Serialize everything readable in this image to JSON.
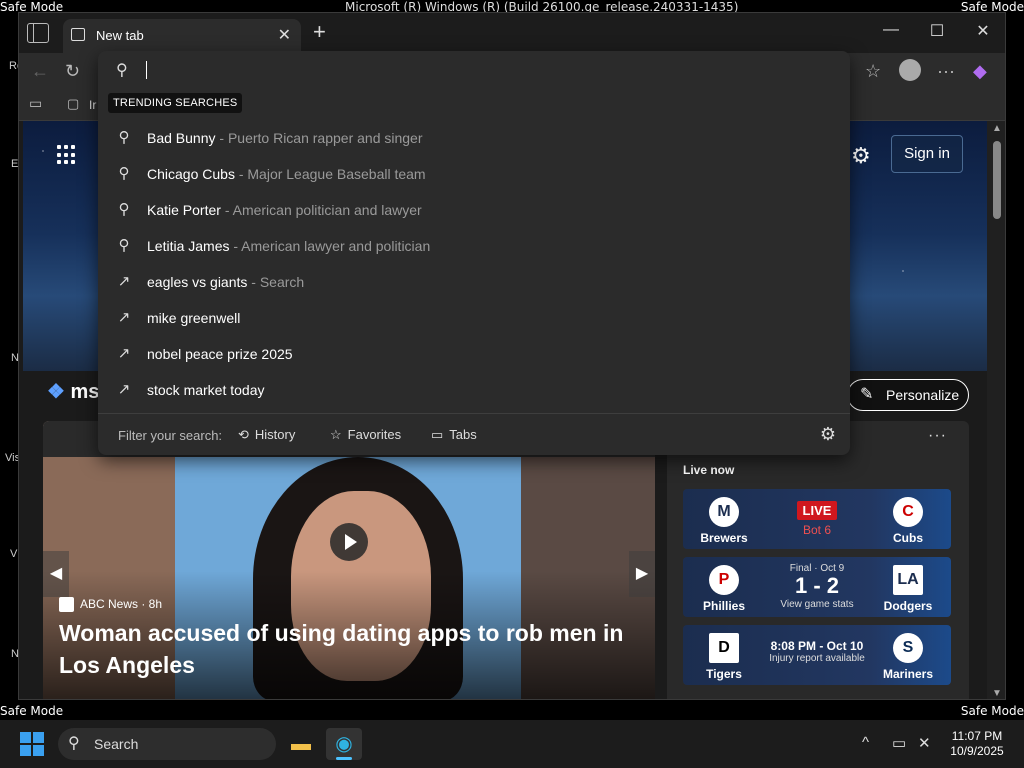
{
  "desktop": {
    "title_bar_text": "Microsoft (R) Windows (R) (Build 26100.ge_release.240331-1435)",
    "safe_mode_label": "Safe Mode",
    "icon_labels": [
      "Re",
      "E",
      "N",
      "Vis",
      "V",
      "N"
    ]
  },
  "browser": {
    "tab_title": "New tab",
    "favbar_item": "Ir"
  },
  "msn": {
    "logo_text": "ms",
    "sign_in": "Sign in",
    "personalize": "Personalize"
  },
  "search_dropdown": {
    "input_value": "",
    "section_label": "TRENDING SEARCHES",
    "suggestions": [
      {
        "icon": "search-icon",
        "term": "Bad Bunny",
        "desc": " - Puerto Rican rapper and singer"
      },
      {
        "icon": "search-icon",
        "term": "Chicago Cubs",
        "desc": " - Major League Baseball team"
      },
      {
        "icon": "search-icon",
        "term": "Katie Porter",
        "desc": " - American politician and lawyer"
      },
      {
        "icon": "search-icon",
        "term": "Letitia James",
        "desc": " - American lawyer and politician"
      },
      {
        "icon": "trending-icon",
        "term": "eagles vs giants",
        "desc": " - Search"
      },
      {
        "icon": "trending-icon",
        "term": "mike greenwell",
        "desc": ""
      },
      {
        "icon": "trending-icon",
        "term": "nobel peace prize 2025",
        "desc": ""
      },
      {
        "icon": "trending-icon",
        "term": "stock market today",
        "desc": ""
      }
    ],
    "filter_label": "Filter your search:",
    "filters": {
      "history": "History",
      "favorites": "Favorites",
      "tabs": "Tabs"
    }
  },
  "hero": {
    "source": "ABC News · 8h",
    "headline": "Woman accused of using dating apps to rob men in Los Angeles"
  },
  "sports": {
    "live_now": "Live now",
    "games": [
      {
        "home": "Brewers",
        "away": "Cubs",
        "badge": "LIVE",
        "status": "Bot 6",
        "home_logo": "M",
        "away_logo": "C"
      },
      {
        "home": "Phillies",
        "away": "Dodgers",
        "header": "Final · Oct 9",
        "score": "1 - 2",
        "sub": "View game stats",
        "home_logo": "P",
        "away_logo": "LA"
      },
      {
        "home": "Tigers",
        "away": "Mariners",
        "time": "8:08 PM - Oct 10",
        "sub": "Injury report available",
        "home_logo": "D",
        "away_logo": "S"
      }
    ]
  },
  "taskbar": {
    "search_label": "Search",
    "time": "11:07 PM",
    "date": "10/9/2025"
  }
}
